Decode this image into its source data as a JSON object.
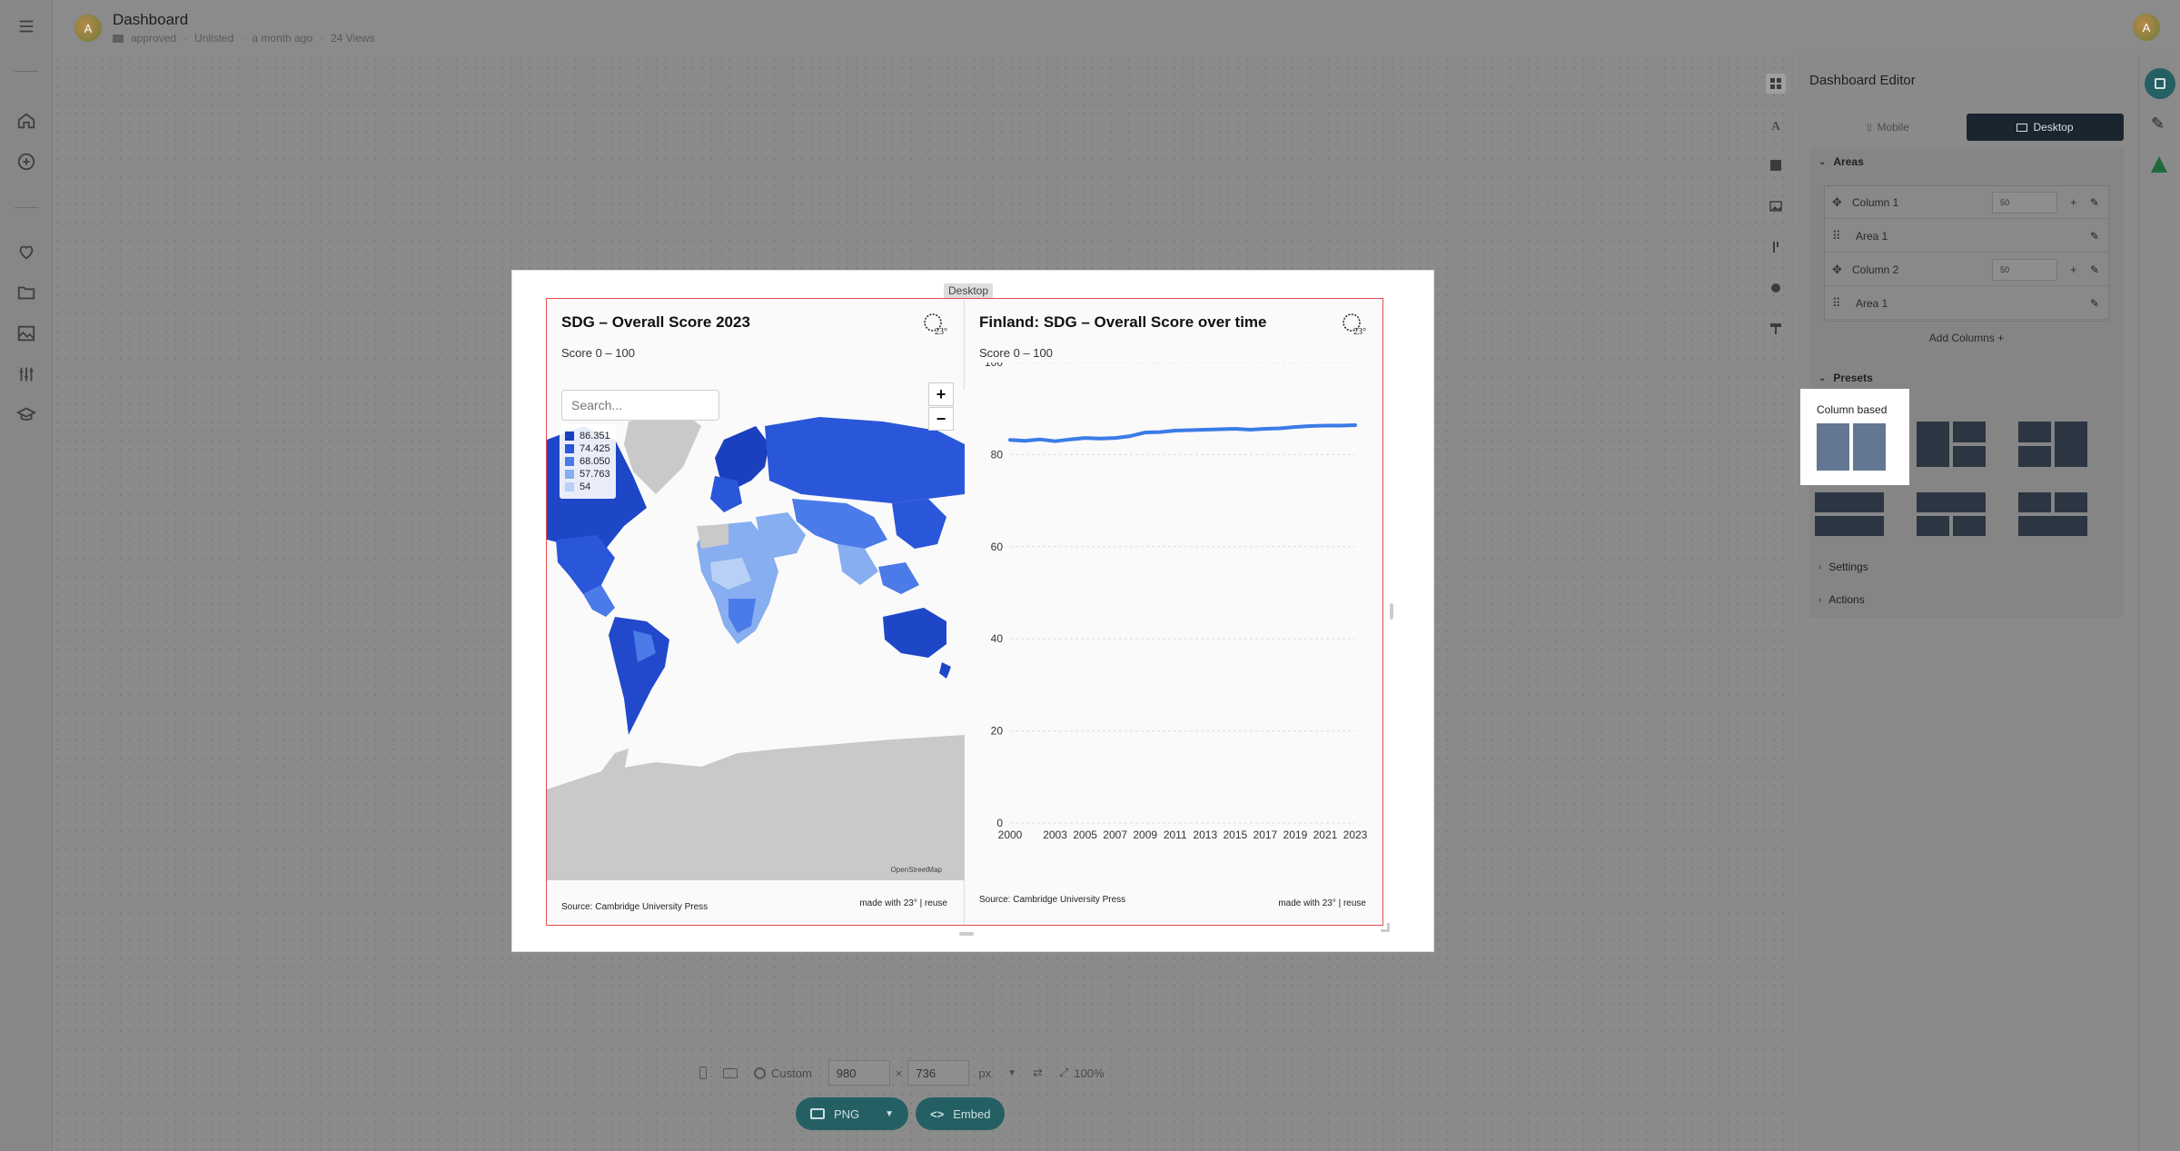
{
  "app": {
    "dashboard_title": "Dashboard",
    "status": "approved",
    "visibility": "Unlisted",
    "updated": "a month ago",
    "views": "24 Views",
    "avatar_letter": "A"
  },
  "frame": {
    "label": "Desktop"
  },
  "map_panel": {
    "title": "SDG – Overall Score 2023",
    "subtitle": "Score 0 – 100",
    "search_placeholder": "Search...",
    "zoom_in": "+",
    "zoom_out": "−",
    "legend": [
      {
        "label": "86.351",
        "color": "#1a3fbf"
      },
      {
        "label": "74.425",
        "color": "#2a56d9"
      },
      {
        "label": "68.050",
        "color": "#4a7be8"
      },
      {
        "label": "57.763",
        "color": "#86aef0"
      },
      {
        "label": "54",
        "color": "#b8d0f6"
      }
    ],
    "attribution": "OpenStreetMap",
    "source_label": "Source:",
    "source": "Cambridge University Press",
    "made_with": "made with 23° | reuse"
  },
  "line_panel": {
    "title": "Finland: SDG – Overall Score over time",
    "subtitle": "Score 0 – 100",
    "source_label": "Source:",
    "source": "Cambridge University Press",
    "made_with": "made with 23° | reuse"
  },
  "chart_data": {
    "type": "line",
    "title": "Finland: SDG – Overall Score over time",
    "subtitle": "Score 0 – 100",
    "ylim": [
      0,
      100
    ],
    "y_ticks": [
      0,
      20,
      40,
      60,
      80,
      100
    ],
    "x_tick_labels": [
      "2000",
      "2003",
      "2005",
      "2007",
      "2009",
      "2011",
      "2013",
      "2015",
      "2017",
      "2019",
      "2021",
      "2023"
    ],
    "grid": true,
    "color": "#3b7be8",
    "series": [
      {
        "x": [
          2000,
          2001,
          2002,
          2003,
          2004,
          2005,
          2006,
          2007,
          2008,
          2009,
          2010,
          2011,
          2012,
          2013,
          2014,
          2015,
          2016,
          2017,
          2018,
          2019,
          2020,
          2021,
          2022,
          2023
        ],
        "values": [
          83.2,
          83.0,
          83.3,
          82.9,
          83.3,
          83.6,
          83.5,
          83.6,
          84.0,
          84.8,
          84.9,
          85.2,
          85.3,
          85.4,
          85.5,
          85.6,
          85.4,
          85.6,
          85.7,
          86.0,
          86.2,
          86.3,
          86.3,
          86.4
        ]
      }
    ]
  },
  "bottom_toolbar": {
    "preset": "Custom",
    "width": "980",
    "height": "736",
    "times": "×",
    "unit": "px",
    "zoom": "100%",
    "png_label": "PNG",
    "embed_label": "Embed"
  },
  "editor": {
    "title": "Dashboard Editor",
    "mobile_label": "Mobile",
    "desktop_label": "Desktop",
    "areas_label": "Areas",
    "rows": [
      {
        "label": "Column 1",
        "value": "50",
        "type": "column"
      },
      {
        "label": "Area 1",
        "type": "area"
      },
      {
        "label": "Column 2",
        "value": "50",
        "type": "column"
      },
      {
        "label": "Area 1",
        "type": "area"
      }
    ],
    "add_columns": "Add Columns  +",
    "presets_label": "Presets",
    "preset_highlight_label": "Column based",
    "settings_label": "Settings",
    "actions_label": "Actions"
  }
}
